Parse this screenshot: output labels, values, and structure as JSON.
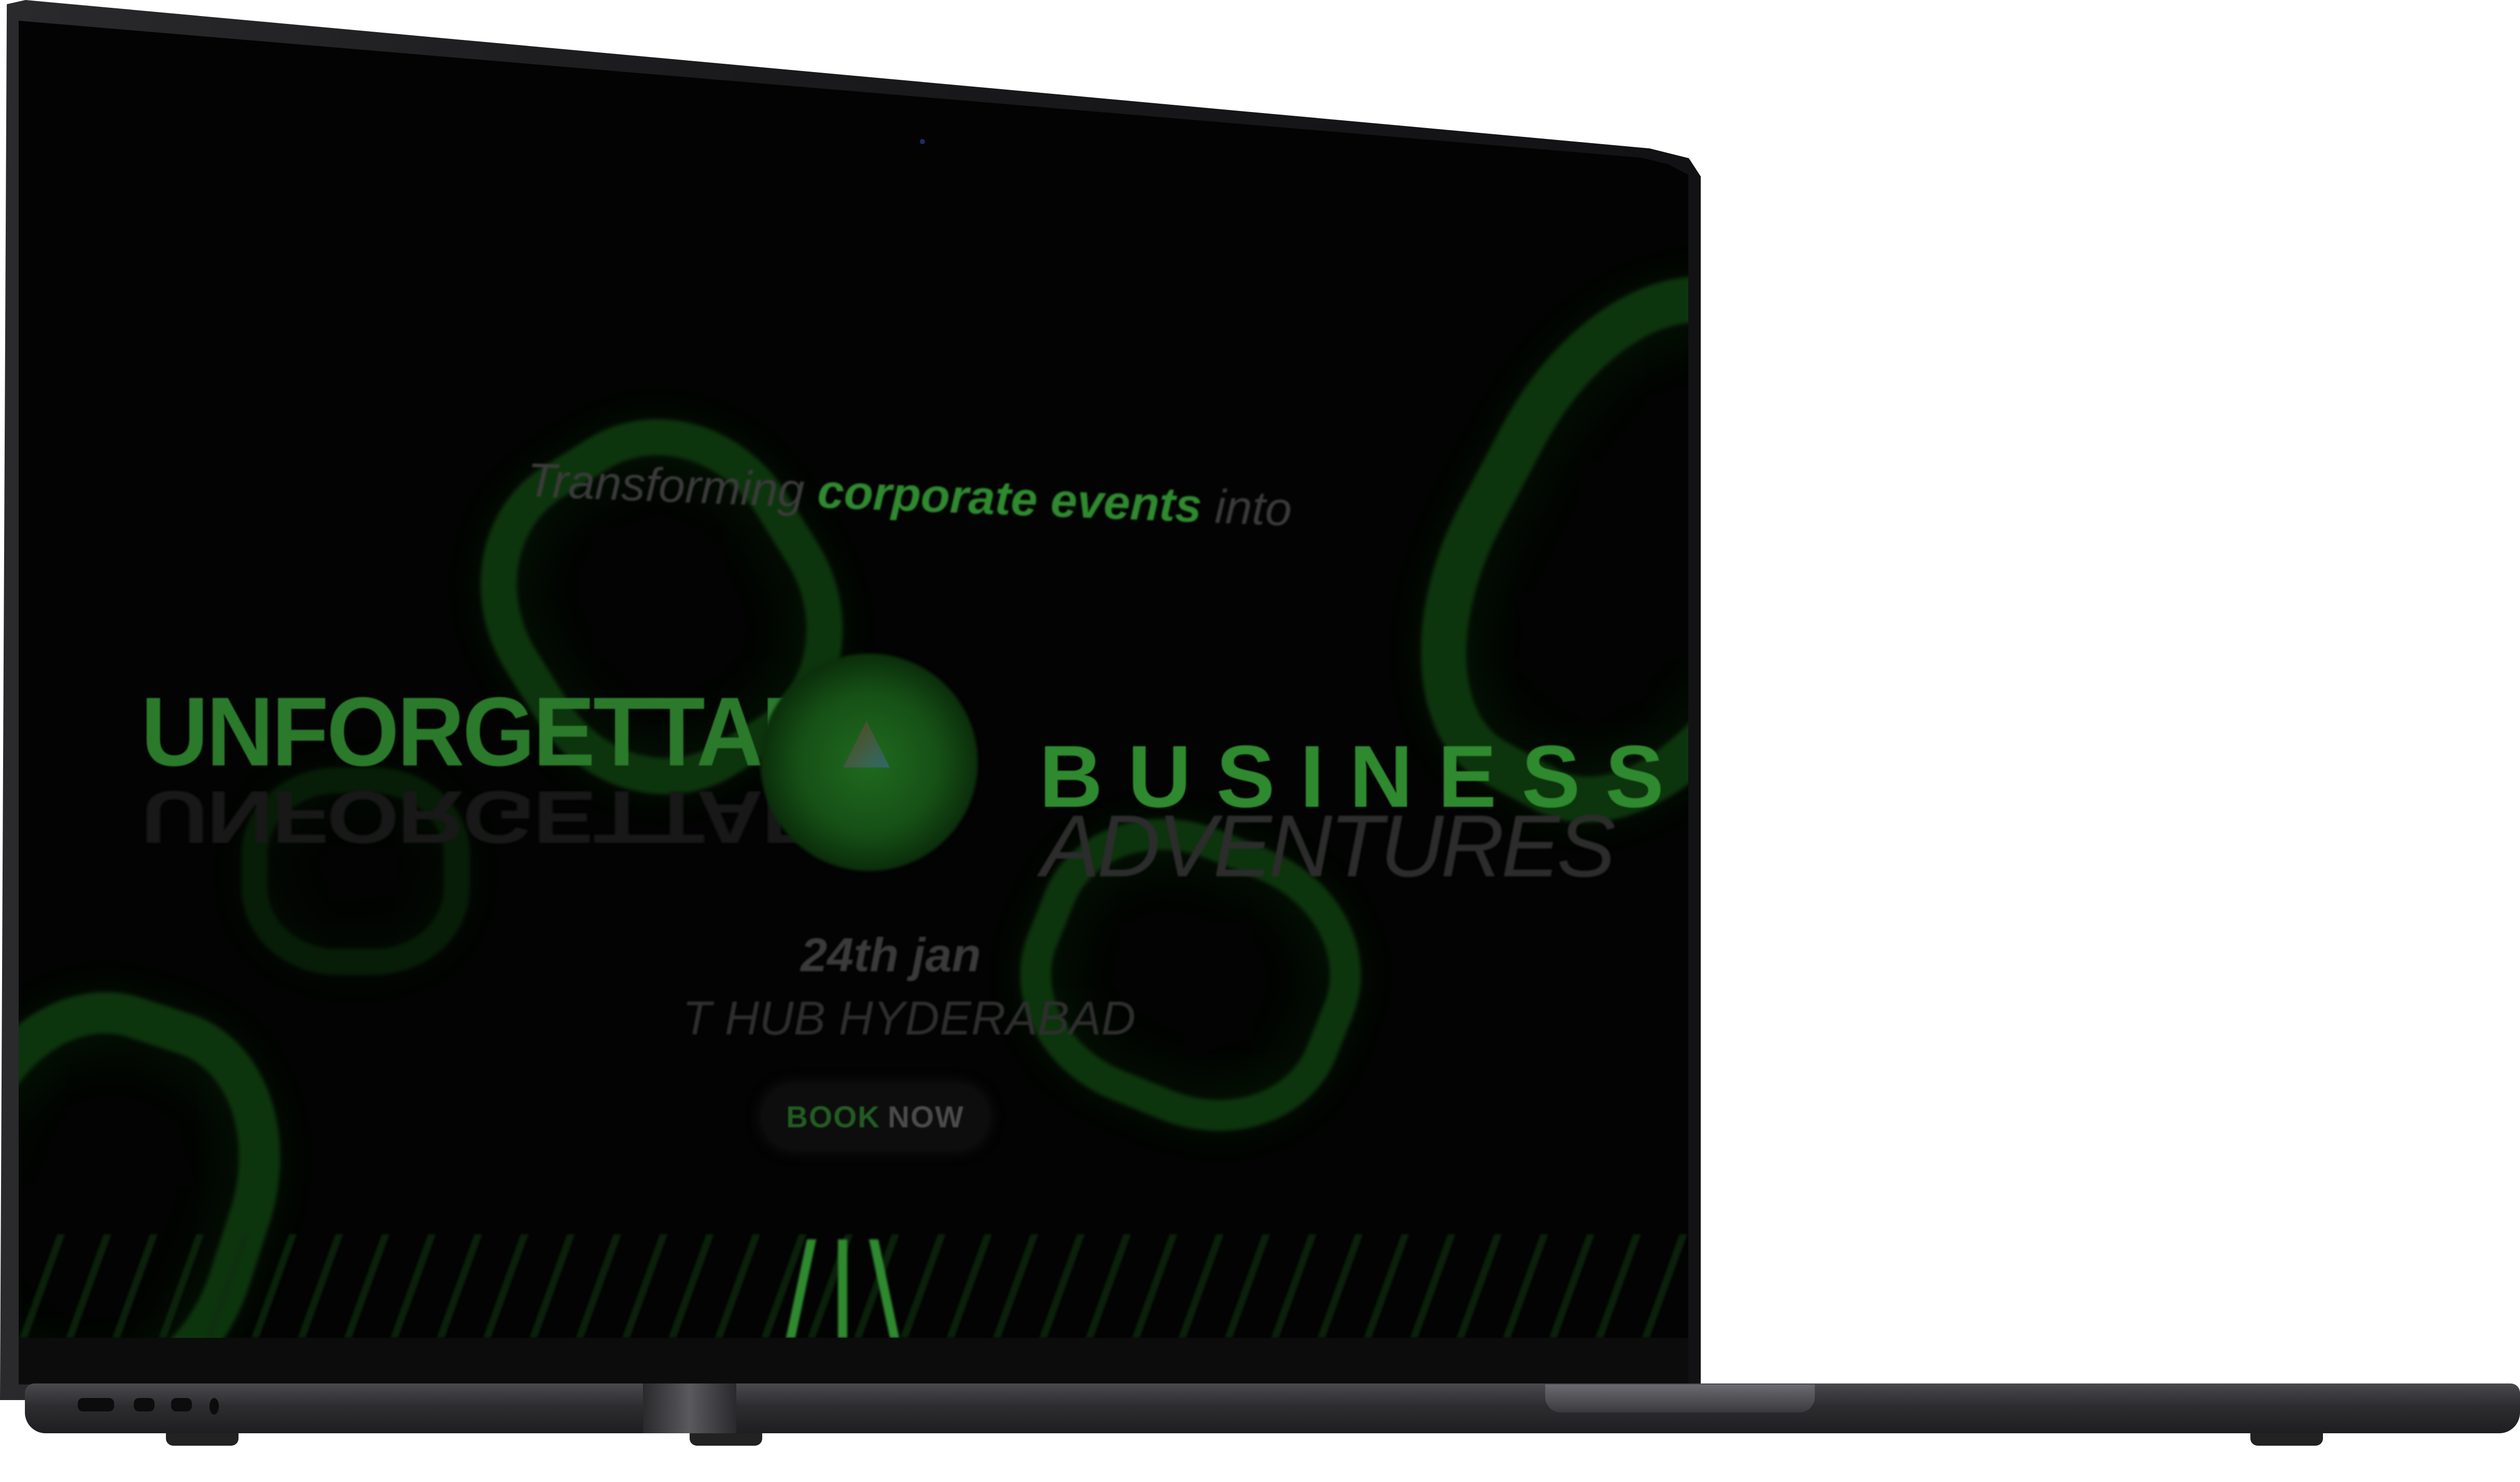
{
  "screen": {
    "tagline": {
      "prefix": "Transforming",
      "highlight": "corporate events",
      "suffix": "into"
    },
    "headline_left": "UNFORGETTABLE",
    "headline_right_1": "BUSINESS",
    "headline_right_2": "ADVENTURES",
    "event_date": "24th jan",
    "event_venue": "T HUB  HYDERABAD",
    "cta": {
      "part1": "BOOK",
      "part2": "NOW"
    }
  },
  "colors": {
    "accent_green": "#2f8a2f",
    "background": "#020302",
    "laptop_body": "#2d2d30"
  }
}
